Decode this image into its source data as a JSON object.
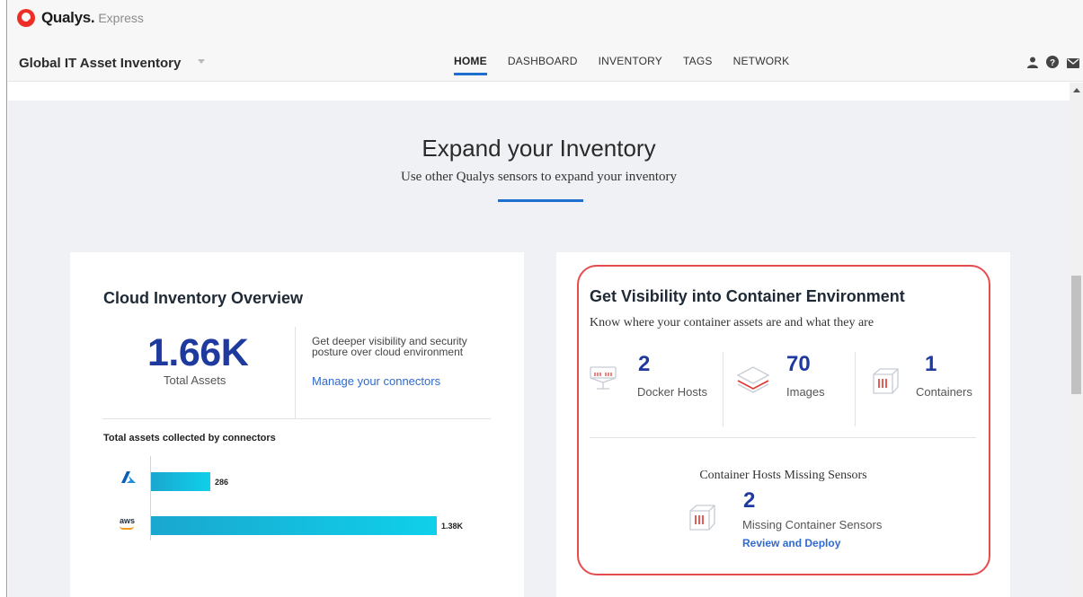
{
  "app": {
    "brand": "Qualys.",
    "brand_sub": "Express",
    "module_title": "Global IT Asset Inventory"
  },
  "nav": {
    "tabs": [
      {
        "label": "HOME",
        "active": true
      },
      {
        "label": "DASHBOARD",
        "active": false
      },
      {
        "label": "INVENTORY",
        "active": false
      },
      {
        "label": "TAGS",
        "active": false
      },
      {
        "label": "NETWORK",
        "active": false
      }
    ],
    "icons": [
      "user-icon",
      "help-icon",
      "mail-icon"
    ]
  },
  "hero": {
    "title": "Expand your Inventory",
    "subtitle": "Use other Qualys sensors to expand your inventory"
  },
  "cloud_card": {
    "title": "Cloud Inventory Overview",
    "total_value": "1.66K",
    "total_label": "Total Assets",
    "description": "Get deeper visibility and security posture over cloud environment",
    "link": "Manage your connectors",
    "bars_title": "Total assets collected by connectors",
    "connectors": [
      {
        "icon": "azure-icon",
        "label": "286",
        "value": 286
      },
      {
        "icon": "aws-icon",
        "logo_text": "aws",
        "label": "1.38K",
        "value": 1380
      }
    ]
  },
  "container_card": {
    "title": "Get Visibility into Container Environment",
    "subtitle": "Know where your container assets are and what they are",
    "metrics": [
      {
        "icon": "docker-host-icon",
        "value": "2",
        "label": "Docker Hosts"
      },
      {
        "icon": "images-icon",
        "value": "70",
        "label": "Images"
      },
      {
        "icon": "container-icon",
        "value": "1",
        "label": "Containers"
      }
    ],
    "missing": {
      "title": "Container Hosts Missing Sensors",
      "value": "2",
      "label": "Missing Container Sensors",
      "link": "Review and Deploy"
    }
  },
  "colors": {
    "accent": "#1f6fd1",
    "number": "#1f3a9e",
    "highlight": "#e74c4c",
    "brand": "#ed2e26"
  }
}
